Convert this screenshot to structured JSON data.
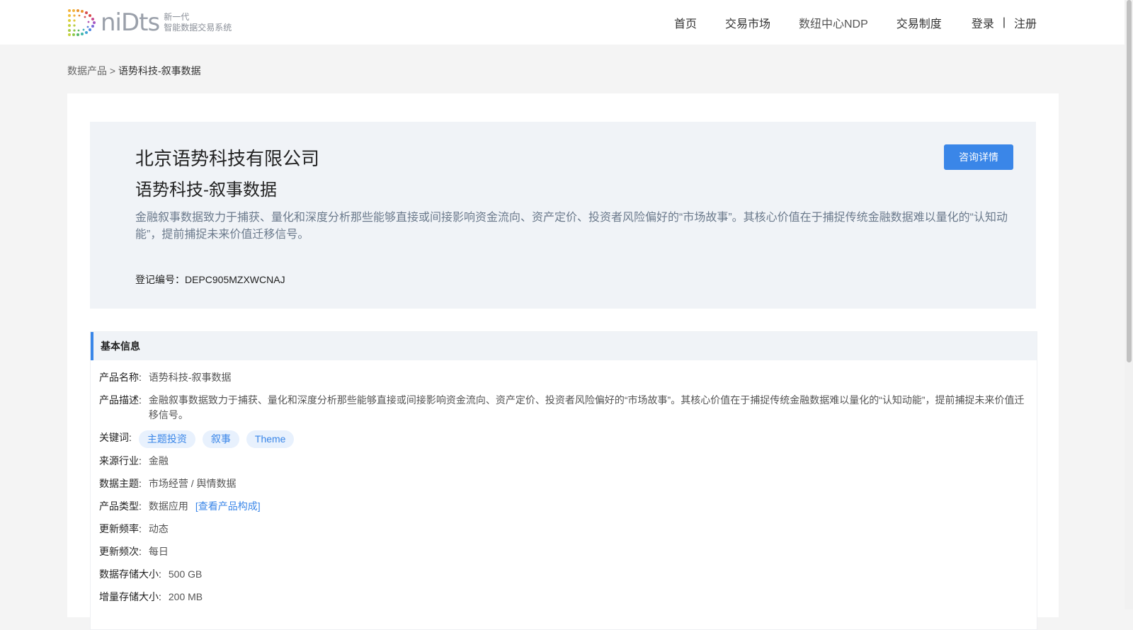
{
  "header": {
    "logo_word": "niDts",
    "logo_sub_line1": "新一代",
    "logo_sub_line2": "智能数据交易系统",
    "nav": [
      "首页",
      "交易市场",
      "数纽中心NDP",
      "交易制度"
    ],
    "login": "登录",
    "separator": "|",
    "register": "注册"
  },
  "breadcrumb": {
    "parent": "数据产品",
    "sep": " > ",
    "current": "语势科技-叙事数据"
  },
  "hero": {
    "company": "北京语势科技有限公司",
    "product_name": "语势科技-叙事数据",
    "description": "金融叙事数据致力于捕获、量化和深度分析那些能够直接或间接影响资金流向、资产定价、投资者风险偏好的“市场故事”。其核心价值在于捕捉传统金融数据难以量化的“认知动能”，提前捕捉未来价值迁移信号。",
    "reg_label": "登记编号：",
    "reg_no": "DEPC905MZXWCNAJ",
    "consult_button": "咨询详情"
  },
  "basic_info": {
    "title": "基本信息",
    "name_label": "产品名称:",
    "name_value": "语势科技-叙事数据",
    "desc_label": "产品描述:",
    "desc_value": "金融叙事数据致力于捕获、量化和深度分析那些能够直接或间接影响资金流向、资产定价、投资者风险偏好的“市场故事”。其核心价值在于捕捉传统金融数据难以量化的“认知动能”，提前捕捉未来价值迁移信号。",
    "keywords_label": "关键词:",
    "keywords": [
      "主题投资",
      "叙事",
      "Theme"
    ],
    "industry_label": "来源行业:",
    "industry_value": "金融",
    "theme_label": "数据主题:",
    "theme_value": "市场经营 / 舆情数据",
    "type_label": "产品类型:",
    "type_value": "数据应用",
    "type_link": "[查看产品构成]",
    "update_rate_label": "更新频率:",
    "update_rate_value": "动态",
    "update_freq_label": "更新频次:",
    "update_freq_value": "每日",
    "storage_label": "数据存储大小:",
    "storage_value": "500 GB",
    "incr_label": "增量存储大小:",
    "incr_value": "200 MB"
  },
  "colors": {
    "accent": "#3a86e8",
    "hero_bg": "#f0f3f7",
    "page_bg": "#f4f4f4"
  }
}
